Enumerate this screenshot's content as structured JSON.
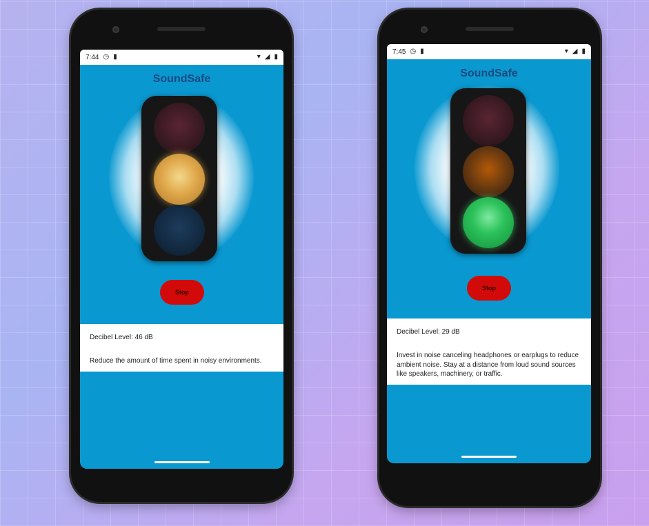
{
  "screens": [
    {
      "status_time": "7:44",
      "app_title": "SoundSafe",
      "stop_label": "Stop",
      "decibel_text": "Decibel Level: 46 dB",
      "advice": "Reduce the amount of time spent in noisy environments.",
      "active_light": "yellow"
    },
    {
      "status_time": "7:45",
      "app_title": "SoundSafe",
      "stop_label": "Stop",
      "decibel_text": "Decibel Level: 29 dB",
      "advice": "Invest in noise canceling headphones or earplugs to reduce ambient noise. Stay at a distance from loud sound sources like speakers, machinery, or traffic.",
      "active_light": "green"
    }
  ],
  "icons": {
    "status_left": [
      "alarm-icon",
      "sim-icon"
    ],
    "status_right": [
      "wifi-icon",
      "signal-icon",
      "battery-icon"
    ]
  },
  "colors": {
    "screen_bg": "#0a98d0",
    "title": "#184a80",
    "stop_button": "#d30a0a",
    "yellow_lamp": "#e0a84b",
    "green_lamp": "#2cc25a"
  }
}
